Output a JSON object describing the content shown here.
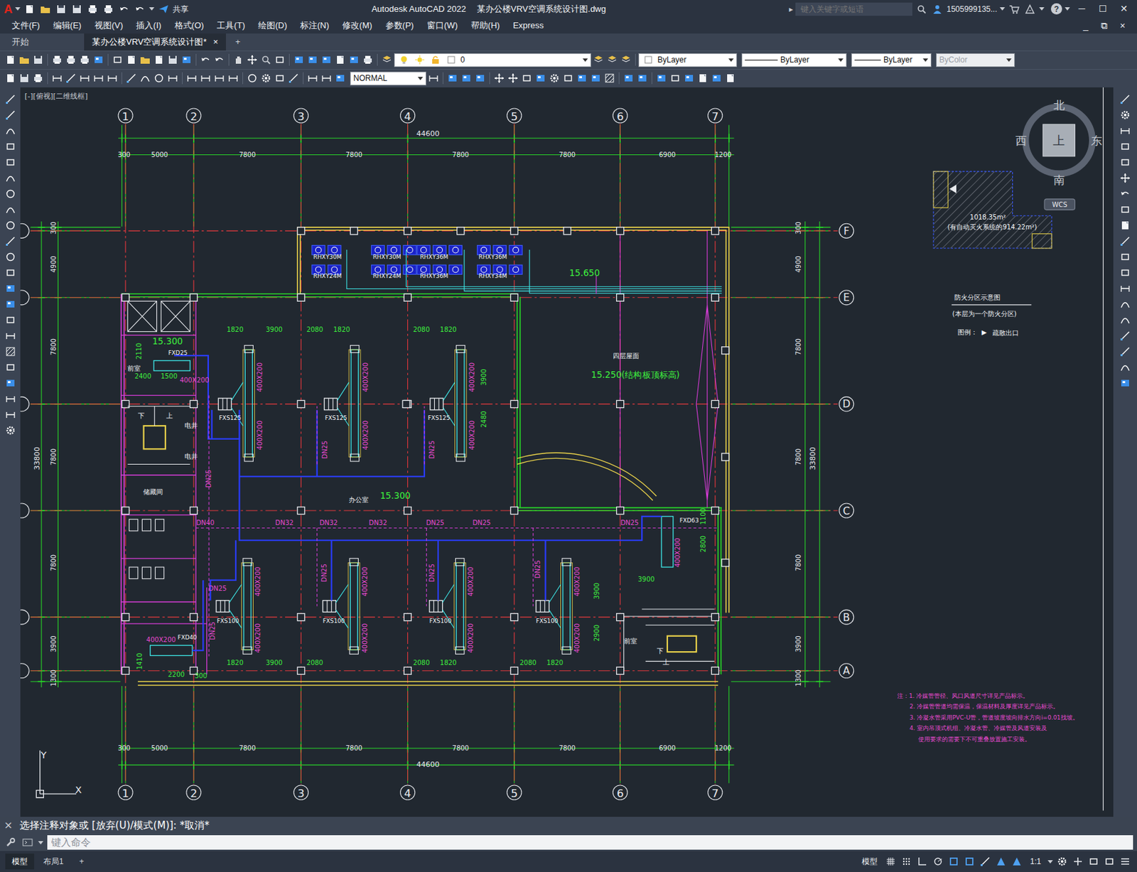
{
  "window": {
    "logo": "A",
    "app": "Autodesk AutoCAD 2022",
    "file": "某办公楼VRV空调系统设计图.dwg",
    "share": "共享",
    "controls": [
      "─",
      "☐",
      "✕"
    ]
  },
  "search": {
    "arrow": "▸",
    "placeholder": "键入关键字或短语",
    "user": "1505999135...",
    "help": "?"
  },
  "menu": {
    "items": [
      "文件(F)",
      "编辑(E)",
      "视图(V)",
      "插入(I)",
      "格式(O)",
      "工具(T)",
      "绘图(D)",
      "标注(N)",
      "修改(M)",
      "参数(P)",
      "窗口(W)",
      "帮助(H)",
      "Express"
    ],
    "controls": [
      "_",
      "⧉",
      "×"
    ]
  },
  "tabs": [
    {
      "label": "开始",
      "selected": false
    },
    {
      "label": "某办公楼VRV空调系统设计图*",
      "selected": true
    }
  ],
  "tab_close": "×",
  "tab_add": "+",
  "toolbar": {
    "layer": "0",
    "color": "ByLayer",
    "linetype": "ByLayer",
    "lineweight": "ByLayer",
    "plotstyle": {
      "text": "ByColor",
      "disabled": true
    },
    "dimstyle": "NORMAL"
  },
  "viewport": {
    "label": "[-][俯视][二维线框]"
  },
  "viewcube": {
    "north": "北",
    "south": "南",
    "west": "西",
    "east": "东",
    "face": "上",
    "ucs": "WCS"
  },
  "axes": {
    "top": [
      "1",
      "2",
      "3",
      "4",
      "5",
      "6",
      "7"
    ],
    "bottom": [
      "1",
      "2",
      "3",
      "4",
      "5",
      "6",
      "7"
    ],
    "right": [
      "F",
      "E",
      "D",
      "C",
      "B",
      "A"
    ]
  },
  "dimensions": {
    "top_total": "44600",
    "top": [
      "300",
      "5000",
      "7800",
      "7800",
      "7800",
      "7800",
      "6900",
      "1200"
    ],
    "bottom_total": "44600",
    "bottom": [
      "300",
      "5000",
      "7800",
      "7800",
      "7800",
      "7800",
      "6900",
      "1200"
    ],
    "left_total": "33800",
    "left": [
      "300",
      "4900",
      "7800",
      "7800",
      "7800",
      "3900",
      "1300"
    ],
    "right_total": "33800",
    "right": [
      "300",
      "4900",
      "7800",
      "7800",
      "7800",
      "3900",
      "1300"
    ]
  },
  "drawing": {
    "labels": [
      {
        "text": "RHXY30M",
        "kind": "equip"
      },
      {
        "text": "RHXY24M",
        "kind": "equip"
      },
      {
        "text": "RHXY30M",
        "kind": "equip"
      },
      {
        "text": "RHXY24M",
        "kind": "equip"
      },
      {
        "text": "RHXY36M",
        "kind": "equip"
      },
      {
        "text": "RHXY36M",
        "kind": "equip"
      },
      {
        "text": "RHXY36M",
        "kind": "equip"
      },
      {
        "text": "RHXY34M",
        "kind": "equip"
      },
      {
        "text": "FXD25",
        "kind": "equip"
      },
      {
        "text": "FXS125",
        "kind": "equip"
      },
      {
        "text": "FXS125",
        "kind": "equip"
      },
      {
        "text": "FXS125",
        "kind": "equip"
      },
      {
        "text": "FXS100",
        "kind": "equip"
      },
      {
        "text": "FXS100",
        "kind": "equip"
      },
      {
        "text": "FXS100",
        "kind": "equip"
      },
      {
        "text": "FXS100",
        "kind": "equip"
      },
      {
        "text": "FXD40",
        "kind": "equip"
      },
      {
        "text": "FXD63",
        "kind": "equip"
      },
      {
        "text": "15.650",
        "kind": "elev"
      },
      {
        "text": "15.300",
        "kind": "elev"
      },
      {
        "text": "15.300",
        "kind": "elev"
      },
      {
        "text": "15.250(结构板顶标高)",
        "kind": "elev"
      },
      {
        "text": "四层屋面",
        "kind": "room"
      },
      {
        "text": "办公室",
        "kind": "room"
      },
      {
        "text": "前室",
        "kind": "room"
      },
      {
        "text": "储藏间",
        "kind": "room"
      },
      {
        "text": "前室",
        "kind": "room"
      },
      {
        "text": "下",
        "kind": "room"
      },
      {
        "text": "上",
        "kind": "room"
      },
      {
        "text": "下",
        "kind": "room"
      },
      {
        "text": "上",
        "kind": "room"
      },
      {
        "text": "电井",
        "kind": "room"
      },
      {
        "text": "电井",
        "kind": "room"
      },
      {
        "text": "1820",
        "kind": "dim"
      },
      {
        "text": "3900",
        "kind": "dim"
      },
      {
        "text": "2080",
        "kind": "dim"
      },
      {
        "text": "1820",
        "kind": "dim"
      },
      {
        "text": "2080",
        "kind": "dim"
      },
      {
        "text": "1820",
        "kind": "dim"
      },
      {
        "text": "1820",
        "kind": "dim"
      },
      {
        "text": "3900",
        "kind": "dim"
      },
      {
        "text": "2080",
        "kind": "dim"
      },
      {
        "text": "2080",
        "kind": "dim"
      },
      {
        "text": "1820",
        "kind": "dim"
      },
      {
        "text": "2080",
        "kind": "dim"
      },
      {
        "text": "1820",
        "kind": "dim"
      },
      {
        "text": "3900",
        "kind": "dim"
      },
      {
        "text": "2480",
        "kind": "dim"
      },
      {
        "text": "3900",
        "kind": "dim"
      },
      {
        "text": "1100",
        "kind": "dim"
      },
      {
        "text": "2800",
        "kind": "dim"
      },
      {
        "text": "3900",
        "kind": "dim"
      },
      {
        "text": "2900",
        "kind": "dim"
      },
      {
        "text": "2110",
        "kind": "dim"
      },
      {
        "text": "2400",
        "kind": "dim"
      },
      {
        "text": "1500",
        "kind": "dim"
      },
      {
        "text": "1410",
        "kind": "dim"
      },
      {
        "text": "2200",
        "kind": "dim"
      },
      {
        "text": "300",
        "kind": "dim"
      },
      {
        "text": "400X200",
        "kind": "duct"
      },
      {
        "text": "400X200",
        "kind": "duct"
      },
      {
        "text": "400X200",
        "kind": "duct"
      },
      {
        "text": "400X200",
        "kind": "duct"
      },
      {
        "text": "400X200",
        "kind": "duct"
      },
      {
        "text": "400X200",
        "kind": "duct"
      },
      {
        "text": "400X200",
        "kind": "duct"
      },
      {
        "text": "400X200",
        "kind": "duct"
      },
      {
        "text": "400X200",
        "kind": "duct"
      },
      {
        "text": "400X200",
        "kind": "duct"
      },
      {
        "text": "400X200",
        "kind": "duct"
      },
      {
        "text": "400X200",
        "kind": "duct"
      },
      {
        "text": "400X200",
        "kind": "duct"
      },
      {
        "text": "400X200",
        "kind": "duct"
      },
      {
        "text": "400X200",
        "kind": "duct"
      },
      {
        "text": "400X200",
        "kind": "duct"
      },
      {
        "text": "400X200",
        "kind": "duct"
      },
      {
        "text": "DN40",
        "kind": "pipe"
      },
      {
        "text": "DN32",
        "kind": "pipe"
      },
      {
        "text": "DN32",
        "kind": "pipe"
      },
      {
        "text": "DN32",
        "kind": "pipe"
      },
      {
        "text": "DN25",
        "kind": "pipe"
      },
      {
        "text": "DN25",
        "kind": "pipe"
      },
      {
        "text": "DN25",
        "kind": "pipe"
      },
      {
        "text": "DN25",
        "kind": "pipe"
      },
      {
        "text": "DN25",
        "kind": "pipe"
      },
      {
        "text": "DN25",
        "kind": "pipe"
      },
      {
        "text": "DN25",
        "kind": "pipe"
      },
      {
        "text": "DN25",
        "kind": "pipe"
      },
      {
        "text": "DN25",
        "kind": "pipe"
      },
      {
        "text": "DN25",
        "kind": "pipe"
      },
      {
        "text": "DN25",
        "kind": "pipe"
      },
      {
        "text": "1018.35m²",
        "kind": "legend"
      },
      {
        "text": "(有自动灭火系统的914.22m²)",
        "kind": "legend"
      },
      {
        "text": "防火分区示意图",
        "kind": "legend"
      },
      {
        "text": "(本层为一个防火分区)",
        "kind": "legend"
      },
      {
        "text": "图例：",
        "kind": "legend"
      },
      {
        "text": "▶",
        "kind": "legend"
      },
      {
        "text": "疏散出口",
        "kind": "legend"
      },
      {
        "text": "注：1. 冷媒管管径、风口风道尺寸详见产品标示。",
        "kind": "note"
      },
      {
        "text": "2. 冷媒管管道均需保温，保温材料及厚度详见产品标示。",
        "kind": "note"
      },
      {
        "text": "3. 冷凝水管采用PVC-U管，管道坡度坡向排水方向i=0.01找坡。",
        "kind": "note"
      },
      {
        "text": "4. 室内吊顶式机组、冷凝水管、冷媒管及风道安装及",
        "kind": "note"
      },
      {
        "text": "使用要求的需要下不可重叠放置施工安装。",
        "kind": "note"
      }
    ]
  },
  "ucs_icon": {
    "x": "X",
    "y": "Y"
  },
  "command": {
    "close": "×",
    "history": "选择注释对象或 [放弃(U)/模式(M)]: *取消*",
    "placeholder": "键入命令"
  },
  "layouts": [
    {
      "label": "模型",
      "selected": true
    },
    {
      "label": "布局1",
      "selected": false
    }
  ],
  "layout_add": "+",
  "status": {
    "space": "模型",
    "scale": "1:1"
  }
}
